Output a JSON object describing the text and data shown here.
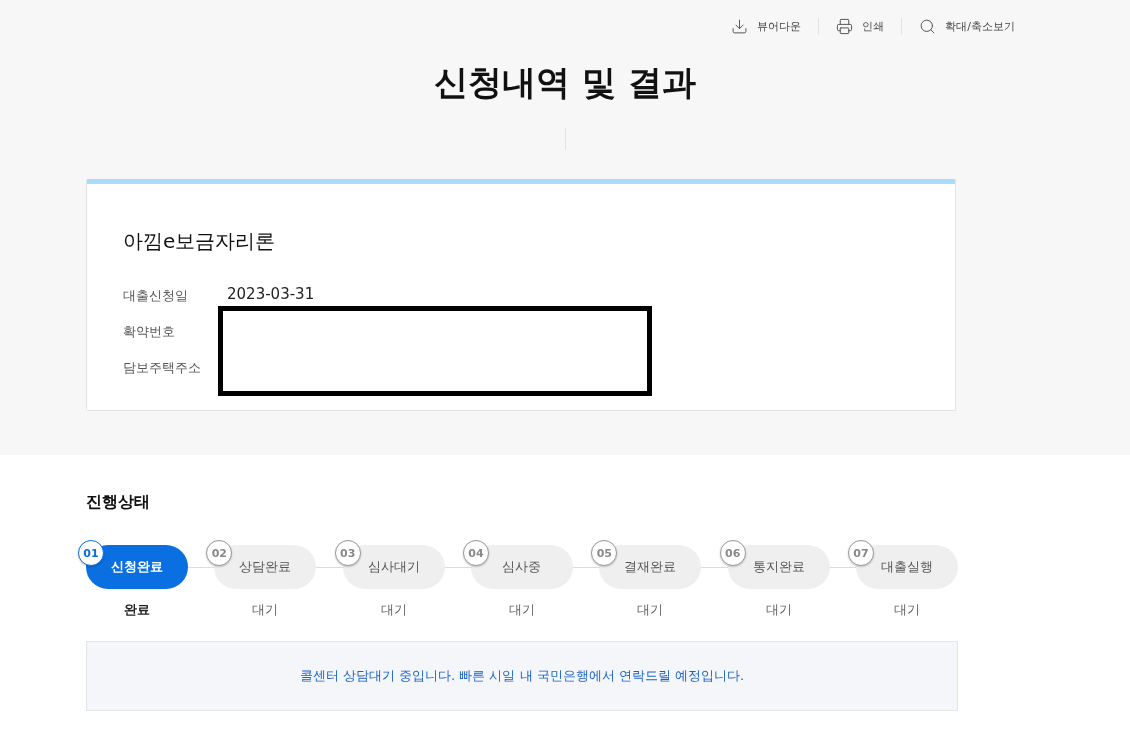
{
  "toolbar": [
    {
      "kind": "download",
      "label": "뷰어다운"
    },
    {
      "kind": "print",
      "label": "인쇄"
    },
    {
      "kind": "zoom",
      "label": "확대/축소보기"
    }
  ],
  "title": "신청내역 및 결과",
  "loan": {
    "name": "아낌e보금자리론",
    "fields": [
      {
        "label": "대출신청일",
        "value": "2023-03-31"
      },
      {
        "label": "확약번호"
      },
      {
        "label": "담보주택주소"
      }
    ]
  },
  "progress": {
    "heading": "진행상태",
    "steps": [
      {
        "number": "01",
        "label": "신청완료",
        "status": "완료",
        "selected": true
      },
      {
        "number": "02",
        "label": "상담완료",
        "status": "대기",
        "selected": false
      },
      {
        "number": "03",
        "label": "심사대기",
        "status": "대기",
        "selected": false
      },
      {
        "number": "04",
        "label": "심사중",
        "status": "대기",
        "selected": false
      },
      {
        "number": "05",
        "label": "결재완료",
        "status": "대기",
        "selected": false
      },
      {
        "number": "06",
        "label": "통지완료",
        "status": "대기",
        "selected": false
      },
      {
        "number": "07",
        "label": "대출실행",
        "status": "대기",
        "selected": false
      }
    ],
    "notice": "콜센터 상담대기 중입니다. 빠른 시일 내 국민은행에서 연락드릴 예정입니다."
  }
}
